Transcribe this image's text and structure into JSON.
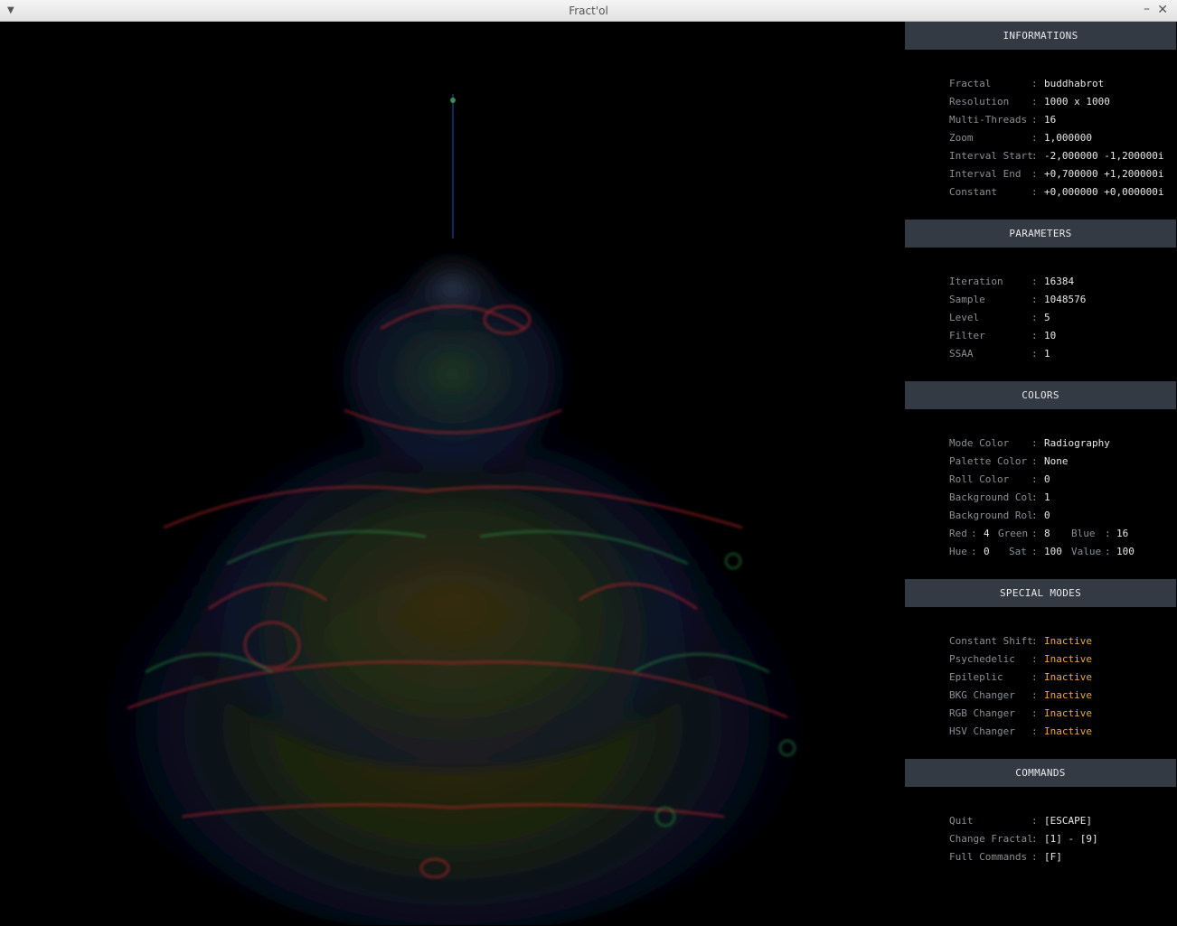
{
  "window": {
    "title": "Fract'ol"
  },
  "sections": {
    "informations": {
      "title": "INFORMATIONS",
      "rows": [
        {
          "label": "Fractal",
          "value": "buddhabrot"
        },
        {
          "label": "Resolution",
          "value": "1000 x 1000"
        },
        {
          "label": "Multi-Threads",
          "value": "16"
        },
        {
          "label": "Zoom",
          "value": "1,000000"
        },
        {
          "label": "Interval Start",
          "value": "-2,000000 -1,200000i"
        },
        {
          "label": "Interval End",
          "value": "+0,700000 +1,200000i"
        },
        {
          "label": "Constant",
          "value": "+0,000000 +0,000000i"
        }
      ]
    },
    "parameters": {
      "title": "PARAMETERS",
      "rows": [
        {
          "label": "Iteration",
          "value": "16384"
        },
        {
          "label": "Sample",
          "value": "1048576"
        },
        {
          "label": "Level",
          "value": "5"
        },
        {
          "label": "Filter",
          "value": "10"
        },
        {
          "label": "SSAA",
          "value": "1"
        }
      ]
    },
    "colors": {
      "title": "COLORS",
      "rows": [
        {
          "label": "Mode Color",
          "value": "Radiography"
        },
        {
          "label": "Palette Color",
          "value": "None"
        },
        {
          "label": "Roll Color",
          "value": "0"
        },
        {
          "label": "Background Col",
          "value": "1"
        },
        {
          "label": "Background Rol",
          "value": "0"
        }
      ],
      "rgb": {
        "red_label": "Red",
        "red": "4",
        "green_label": "Green",
        "green": "8",
        "blue_label": "Blue",
        "blue": "16"
      },
      "hsv": {
        "hue_label": "Hue",
        "hue": "0",
        "sat_label": "Sat",
        "sat": "100",
        "value_label": "Value",
        "value": "100"
      }
    },
    "special_modes": {
      "title": "SPECIAL MODES",
      "rows": [
        {
          "label": "Constant Shift",
          "value": "Inactive"
        },
        {
          "label": "Psychedelic",
          "value": "Inactive"
        },
        {
          "label": "Epileplic",
          "value": "Inactive"
        },
        {
          "label": "BKG Changer",
          "value": "Inactive"
        },
        {
          "label": "RGB Changer",
          "value": "Inactive"
        },
        {
          "label": "HSV Changer",
          "value": "Inactive"
        }
      ]
    },
    "commands": {
      "title": "COMMANDS",
      "rows": [
        {
          "label": "Quit",
          "value": "[ESCAPE]"
        },
        {
          "label": "Change Fractal",
          "value": "[1] - [9]"
        },
        {
          "label": "Full Commands",
          "value": "[F]"
        }
      ]
    }
  },
  "colors": {
    "header_bg": "#343a44",
    "inactive": "#f0a63a",
    "label": "#8a8f95",
    "value": "#e8e8e8"
  },
  "icons": {
    "menu": "chevron-down-icon",
    "minimize": "minimize-icon",
    "close": "close-icon"
  },
  "separator": ":"
}
